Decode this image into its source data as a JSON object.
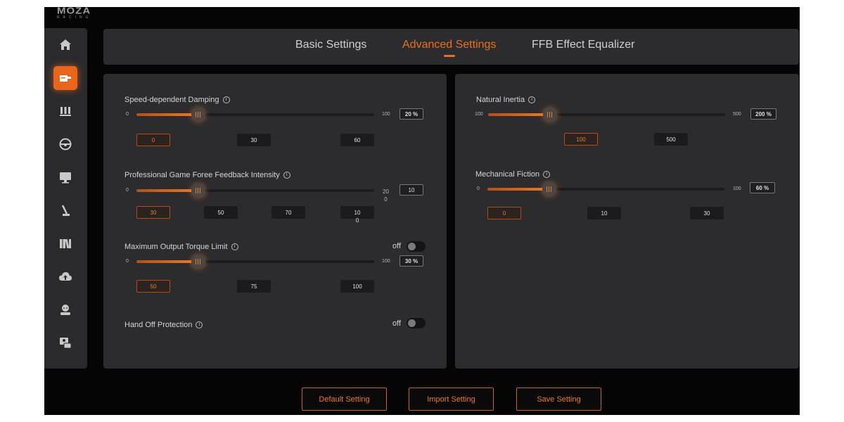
{
  "brand": {
    "name": "MOZA",
    "subtitle": "RACING"
  },
  "sidebar": {
    "items": [
      {
        "icon": "home-icon"
      },
      {
        "icon": "wheelbase-icon",
        "active": true
      },
      {
        "icon": "pedals-icon"
      },
      {
        "icon": "steering-wheel-icon"
      },
      {
        "icon": "dashboard-display-icon"
      },
      {
        "icon": "shifter-icon"
      },
      {
        "icon": "library-icon"
      },
      {
        "icon": "cloud-upload-icon"
      },
      {
        "icon": "profile-icon"
      },
      {
        "icon": "support-icon"
      }
    ]
  },
  "tabs": [
    {
      "label": "Basic Settings",
      "active": false
    },
    {
      "label": "Advanced Settings",
      "active": true
    },
    {
      "label": "FFB Effect Equalizer",
      "active": false
    }
  ],
  "left_panel": {
    "damping": {
      "label": "Speed-dependent Damping",
      "min": "0",
      "max": "100",
      "value": "20 %",
      "percent": 26,
      "presets": [
        "0",
        "30",
        "60"
      ]
    },
    "ffb_intensity": {
      "label": "Professional Game Foree Feedback Intensity",
      "min": "0",
      "max": "20\n0",
      "value": "10",
      "percent": 26,
      "presets": [
        "30",
        "50",
        "70",
        "10\n0"
      ]
    },
    "torque": {
      "label": "Maximum Output Torque Limit",
      "toggle": "off",
      "min": "0",
      "max": "100",
      "value": "30 %",
      "percent": 26,
      "presets": [
        "50",
        "75",
        "100"
      ]
    },
    "hand_off": {
      "label": "Hand Off Protection",
      "toggle": "off"
    }
  },
  "right_panel": {
    "inertia": {
      "label": "Natural Inertia",
      "min": "100",
      "max": "500",
      "value": "200 %",
      "percent": 26,
      "presets": [
        "100",
        "500"
      ]
    },
    "friction": {
      "label": "Mechanical Fiction",
      "min": "0",
      "max": "100",
      "value": "60 %",
      "percent": 26,
      "presets": [
        "0",
        "10",
        "30"
      ]
    }
  },
  "buttons": {
    "default": "Default Setting",
    "import": "Import Setting",
    "save": "Save Setting"
  },
  "colors": {
    "accent": "#e8701f",
    "panel": "#2c2c2e",
    "background": "#050505"
  }
}
